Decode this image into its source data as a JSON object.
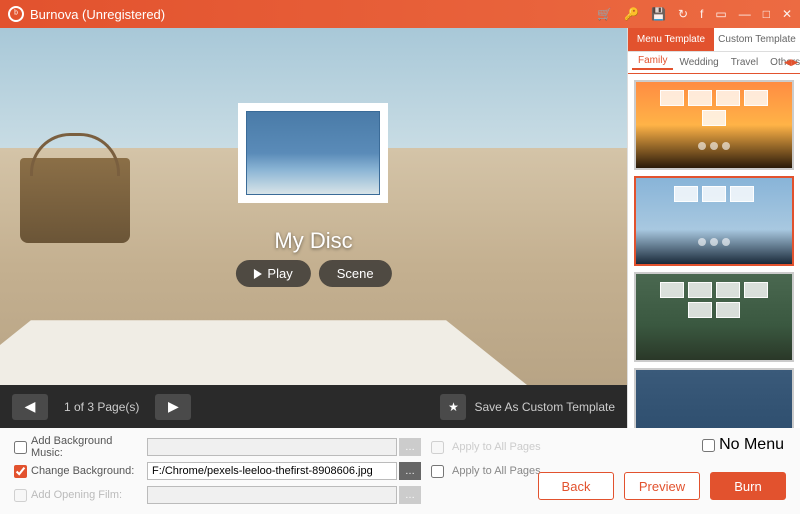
{
  "titlebar": {
    "title": "Burnova (Unregistered)"
  },
  "preview": {
    "disc_title": "My Disc",
    "play_label": "Play",
    "scene_label": "Scene"
  },
  "pager": {
    "text": "1 of 3 Page(s)",
    "save_template": "Save As Custom Template"
  },
  "sidebar": {
    "tabs": [
      "Menu Template",
      "Custom Template"
    ],
    "subtabs": [
      "Family",
      "Wedding",
      "Travel",
      "Others"
    ]
  },
  "controls": {
    "bg_music_label": "Add Background Music:",
    "bg_music_value": "",
    "change_bg_label": "Change Background:",
    "change_bg_value": "F:/Chrome/pexels-leeloo-thefirst-8908606.jpg",
    "opening_film_label": "Add Opening Film:",
    "opening_film_value": "",
    "apply_all": "Apply to All Pages",
    "no_menu": "No Menu"
  },
  "actions": {
    "back": "Back",
    "preview": "Preview",
    "burn": "Burn"
  }
}
